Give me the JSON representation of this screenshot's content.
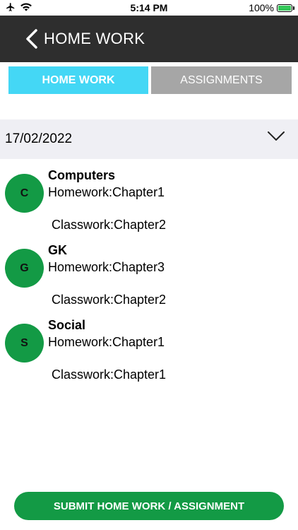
{
  "status_bar": {
    "time": "5:14 PM",
    "battery_percent": "100%",
    "icons": [
      "airplane-icon",
      "wifi-icon",
      "battery-icon"
    ]
  },
  "header": {
    "title": "HOME WORK",
    "back_icon": "chevron-left-icon"
  },
  "tabs": [
    {
      "label": "HOME WORK",
      "active": true
    },
    {
      "label": "ASSIGNMENTS",
      "active": false
    }
  ],
  "date_selector": {
    "value": "17/02/2022",
    "icon": "chevron-down-icon"
  },
  "subjects": [
    {
      "initial": "C",
      "name": "Computers",
      "homework": "Homework:Chapter1",
      "classwork": "Classwork:Chapter2"
    },
    {
      "initial": "G",
      "name": "GK",
      "homework": "Homework:Chapter3",
      "classwork": "Classwork:Chapter2"
    },
    {
      "initial": "S",
      "name": "Social",
      "homework": "Homework:Chapter1",
      "classwork": "Classwork:Chapter1"
    }
  ],
  "submit_button": {
    "label": "SUBMIT HOME WORK / ASSIGNMENT"
  },
  "colors": {
    "header_bg": "#2e2e2e",
    "active_tab": "#44d7f5",
    "inactive_tab": "#a6a6a6",
    "accent_green": "#139a45",
    "date_bar_bg": "#efeff4"
  }
}
